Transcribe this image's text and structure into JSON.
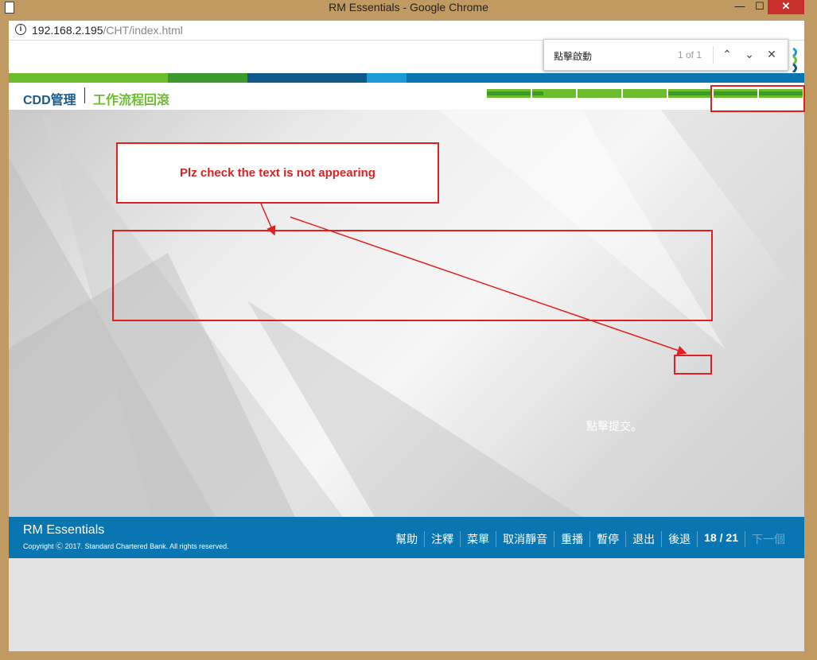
{
  "window": {
    "title": "RM Essentials - Google Chrome",
    "minimize": "—",
    "maximize": "☐",
    "close": "✕"
  },
  "addressbar": {
    "info_icon": "i",
    "host": "192.168.2.195",
    "path": "/CHT/index.html"
  },
  "findbar": {
    "query": "點擊啟動",
    "count": "1 of 1",
    "up": "⌃",
    "down": "⌄",
    "close": "✕"
  },
  "header": {
    "crumb_main": "CDD管理",
    "crumb_sub": "工作流程回滾",
    "stripe_colors": [
      "#6cbd2e",
      "#3a9a2c",
      "#0d5a8a",
      "#1a9ad6",
      "#0a76b1"
    ]
  },
  "progress": {
    "segments": 7,
    "states": [
      "done",
      "part",
      "empty",
      "empty",
      "done",
      "done",
      "done"
    ]
  },
  "content": {
    "hidden_text": "點擊提交。"
  },
  "annotation": {
    "note": "Plz check the text is not appearing",
    "color": "#e02020"
  },
  "footer": {
    "brand": "RM Essentials",
    "copyright": "Copyright Ⓒ 2017. Standard Chartered Bank. All rights reserved.",
    "nav": {
      "help": "幫助",
      "notes": "注釋",
      "menu": "菜單",
      "unmute": "取消靜音",
      "replay": "重播",
      "pause": "暫停",
      "exit": "退出",
      "back": "後退",
      "page": "18 / 21",
      "next": "下一個"
    }
  }
}
